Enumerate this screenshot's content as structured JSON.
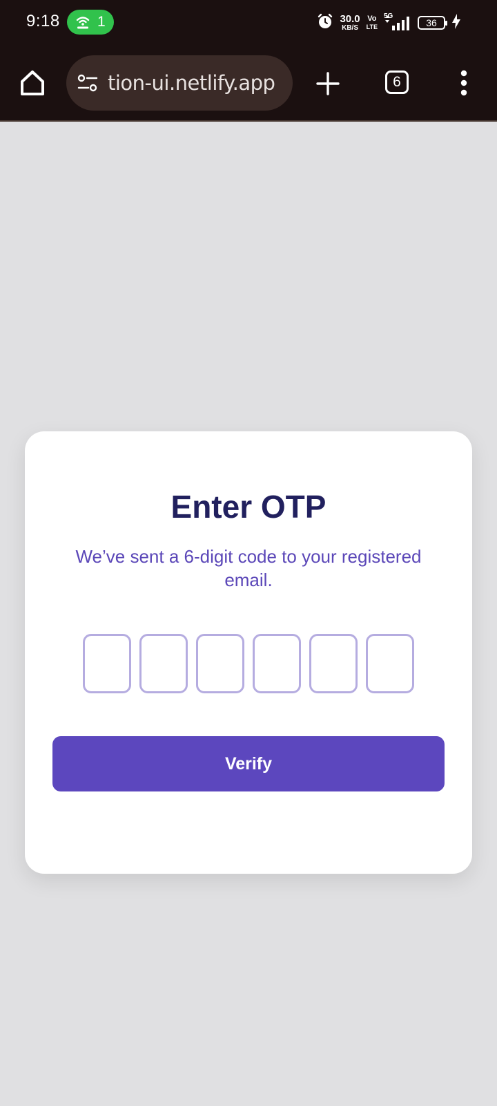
{
  "status_bar": {
    "time": "9:18",
    "hotspot_count": "1",
    "net_speed_value": "30.0",
    "net_speed_unit": "KB/S",
    "volte_top": "Vo",
    "volte_bottom": "LTE",
    "network_type": "5G",
    "battery_level": "36",
    "icons": [
      "hotspot-icon",
      "alarm-icon",
      "signal-icon",
      "battery-icon",
      "charging-icon"
    ]
  },
  "browser": {
    "url": "tion-ui.netlify.app",
    "tab_count": "6",
    "icons": [
      "home-icon",
      "site-settings-icon",
      "new-tab-icon",
      "more-vert-icon"
    ]
  },
  "otp_card": {
    "title": "Enter OTP",
    "subtitle": "We’ve sent a 6-digit code to your registered email.",
    "otp_digits": [
      "",
      "",
      "",
      "",
      "",
      ""
    ],
    "verify_label": "Verify"
  },
  "colors": {
    "page_background": "#e0e0e2",
    "browser_chrome": "#1b1010",
    "hotspot_green": "#31c24c",
    "title": "#21205e",
    "subtitle": "#5b47b8",
    "otp_border": "#b5ace0",
    "accent_button": "#5c47be"
  }
}
